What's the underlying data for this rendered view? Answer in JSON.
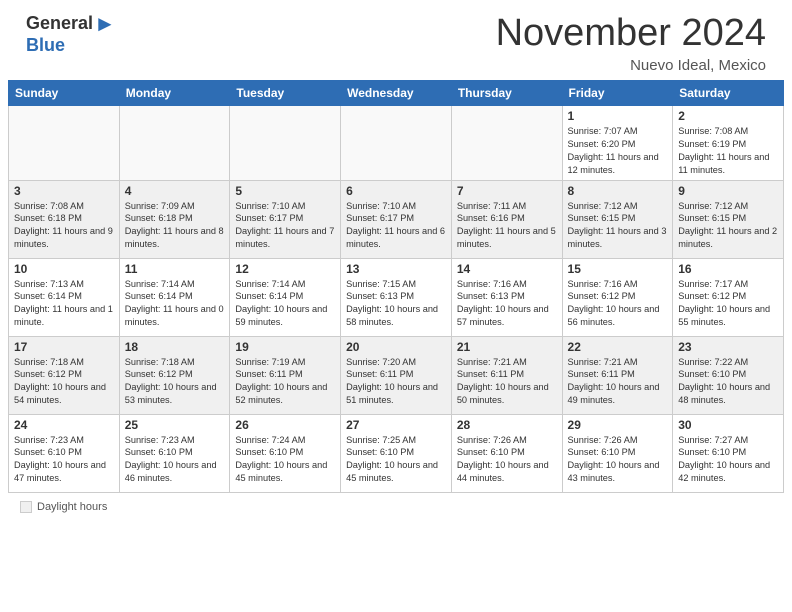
{
  "header": {
    "logo_general": "General",
    "logo_blue": "Blue",
    "month_title": "November 2024",
    "location": "Nuevo Ideal, Mexico"
  },
  "days_of_week": [
    "Sunday",
    "Monday",
    "Tuesday",
    "Wednesday",
    "Thursday",
    "Friday",
    "Saturday"
  ],
  "footer": {
    "daylight_label": "Daylight hours"
  },
  "weeks": [
    [
      {
        "day": "",
        "info": "",
        "empty": true
      },
      {
        "day": "",
        "info": "",
        "empty": true
      },
      {
        "day": "",
        "info": "",
        "empty": true
      },
      {
        "day": "",
        "info": "",
        "empty": true
      },
      {
        "day": "",
        "info": "",
        "empty": true
      },
      {
        "day": "1",
        "info": "Sunrise: 7:07 AM\nSunset: 6:20 PM\nDaylight: 11 hours and 12 minutes."
      },
      {
        "day": "2",
        "info": "Sunrise: 7:08 AM\nSunset: 6:19 PM\nDaylight: 11 hours and 11 minutes."
      }
    ],
    [
      {
        "day": "3",
        "info": "Sunrise: 7:08 AM\nSunset: 6:18 PM\nDaylight: 11 hours and 9 minutes."
      },
      {
        "day": "4",
        "info": "Sunrise: 7:09 AM\nSunset: 6:18 PM\nDaylight: 11 hours and 8 minutes."
      },
      {
        "day": "5",
        "info": "Sunrise: 7:10 AM\nSunset: 6:17 PM\nDaylight: 11 hours and 7 minutes."
      },
      {
        "day": "6",
        "info": "Sunrise: 7:10 AM\nSunset: 6:17 PM\nDaylight: 11 hours and 6 minutes."
      },
      {
        "day": "7",
        "info": "Sunrise: 7:11 AM\nSunset: 6:16 PM\nDaylight: 11 hours and 5 minutes."
      },
      {
        "day": "8",
        "info": "Sunrise: 7:12 AM\nSunset: 6:15 PM\nDaylight: 11 hours and 3 minutes."
      },
      {
        "day": "9",
        "info": "Sunrise: 7:12 AM\nSunset: 6:15 PM\nDaylight: 11 hours and 2 minutes."
      }
    ],
    [
      {
        "day": "10",
        "info": "Sunrise: 7:13 AM\nSunset: 6:14 PM\nDaylight: 11 hours and 1 minute."
      },
      {
        "day": "11",
        "info": "Sunrise: 7:14 AM\nSunset: 6:14 PM\nDaylight: 11 hours and 0 minutes."
      },
      {
        "day": "12",
        "info": "Sunrise: 7:14 AM\nSunset: 6:14 PM\nDaylight: 10 hours and 59 minutes."
      },
      {
        "day": "13",
        "info": "Sunrise: 7:15 AM\nSunset: 6:13 PM\nDaylight: 10 hours and 58 minutes."
      },
      {
        "day": "14",
        "info": "Sunrise: 7:16 AM\nSunset: 6:13 PM\nDaylight: 10 hours and 57 minutes."
      },
      {
        "day": "15",
        "info": "Sunrise: 7:16 AM\nSunset: 6:12 PM\nDaylight: 10 hours and 56 minutes."
      },
      {
        "day": "16",
        "info": "Sunrise: 7:17 AM\nSunset: 6:12 PM\nDaylight: 10 hours and 55 minutes."
      }
    ],
    [
      {
        "day": "17",
        "info": "Sunrise: 7:18 AM\nSunset: 6:12 PM\nDaylight: 10 hours and 54 minutes."
      },
      {
        "day": "18",
        "info": "Sunrise: 7:18 AM\nSunset: 6:12 PM\nDaylight: 10 hours and 53 minutes."
      },
      {
        "day": "19",
        "info": "Sunrise: 7:19 AM\nSunset: 6:11 PM\nDaylight: 10 hours and 52 minutes."
      },
      {
        "day": "20",
        "info": "Sunrise: 7:20 AM\nSunset: 6:11 PM\nDaylight: 10 hours and 51 minutes."
      },
      {
        "day": "21",
        "info": "Sunrise: 7:21 AM\nSunset: 6:11 PM\nDaylight: 10 hours and 50 minutes."
      },
      {
        "day": "22",
        "info": "Sunrise: 7:21 AM\nSunset: 6:11 PM\nDaylight: 10 hours and 49 minutes."
      },
      {
        "day": "23",
        "info": "Sunrise: 7:22 AM\nSunset: 6:10 PM\nDaylight: 10 hours and 48 minutes."
      }
    ],
    [
      {
        "day": "24",
        "info": "Sunrise: 7:23 AM\nSunset: 6:10 PM\nDaylight: 10 hours and 47 minutes."
      },
      {
        "day": "25",
        "info": "Sunrise: 7:23 AM\nSunset: 6:10 PM\nDaylight: 10 hours and 46 minutes."
      },
      {
        "day": "26",
        "info": "Sunrise: 7:24 AM\nSunset: 6:10 PM\nDaylight: 10 hours and 45 minutes."
      },
      {
        "day": "27",
        "info": "Sunrise: 7:25 AM\nSunset: 6:10 PM\nDaylight: 10 hours and 45 minutes."
      },
      {
        "day": "28",
        "info": "Sunrise: 7:26 AM\nSunset: 6:10 PM\nDaylight: 10 hours and 44 minutes."
      },
      {
        "day": "29",
        "info": "Sunrise: 7:26 AM\nSunset: 6:10 PM\nDaylight: 10 hours and 43 minutes."
      },
      {
        "day": "30",
        "info": "Sunrise: 7:27 AM\nSunset: 6:10 PM\nDaylight: 10 hours and 42 minutes."
      }
    ]
  ]
}
